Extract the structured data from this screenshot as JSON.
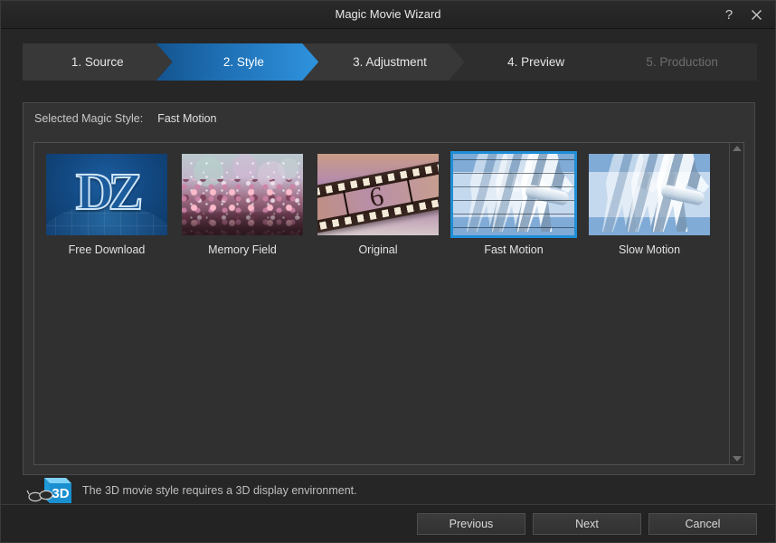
{
  "window": {
    "title": "Magic Movie Wizard",
    "help_icon": "question-mark-icon",
    "close_icon": "close-icon"
  },
  "steps": [
    {
      "label": "1. Source",
      "state": "normal"
    },
    {
      "label": "2. Style",
      "state": "active"
    },
    {
      "label": "3. Adjustment",
      "state": "normal"
    },
    {
      "label": "4. Preview",
      "state": "normal"
    },
    {
      "label": "5. Production",
      "state": "disabled"
    }
  ],
  "panel": {
    "selected_style_label": "Selected Magic Style:",
    "selected_style_value": "Fast Motion"
  },
  "styles": [
    {
      "label": "Free Download",
      "art": "dz",
      "selected": false
    },
    {
      "label": "Memory Field",
      "art": "memory",
      "selected": false
    },
    {
      "label": "Original",
      "art": "original",
      "selected": false
    },
    {
      "label": "Fast Motion",
      "art": "fast",
      "selected": true
    },
    {
      "label": "Slow Motion",
      "art": "slow",
      "selected": false
    }
  ],
  "film_frame_number": "6",
  "scrollbar": {
    "up_icon": "scroll-up-arrow-icon",
    "down_icon": "scroll-down-arrow-icon"
  },
  "notice": {
    "icon": "3d-cube-glasses-icon",
    "icon_text": "3D",
    "text": "The 3D movie style requires a 3D display environment."
  },
  "footer": {
    "previous_label": "Previous",
    "next_label": "Next",
    "cancel_label": "Cancel"
  },
  "colors": {
    "accent": "#1f8ed6",
    "step_active_start": "#14548f",
    "step_active_end": "#2f93de",
    "panel_bg": "#333333",
    "window_bg": "#262626"
  }
}
